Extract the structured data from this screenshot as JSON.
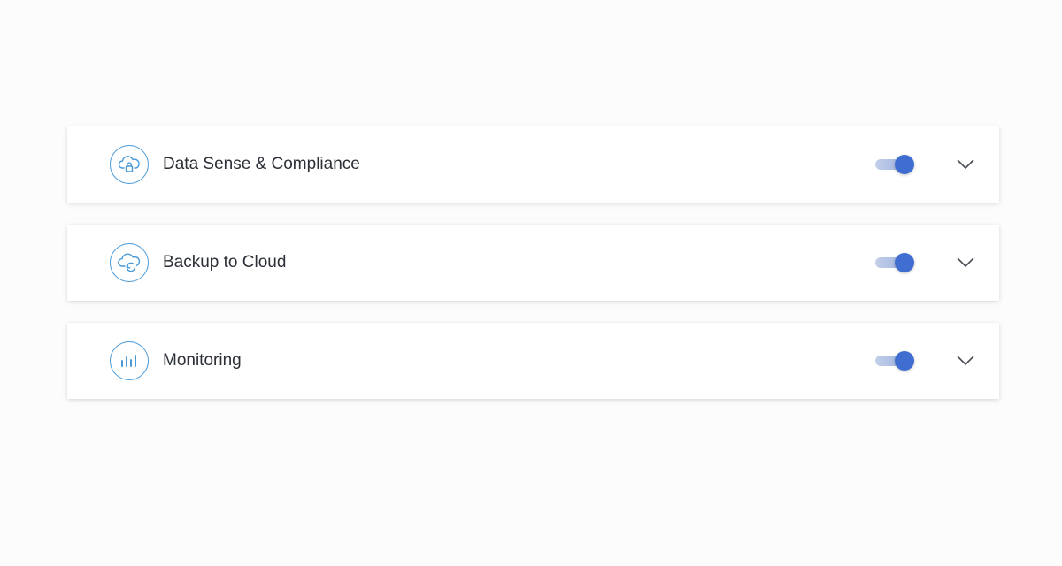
{
  "services": [
    {
      "label": "Data Sense & Compliance",
      "icon": "cloud-lock-icon",
      "enabled": true
    },
    {
      "label": "Backup to Cloud",
      "icon": "cloud-backup-icon",
      "enabled": true
    },
    {
      "label": "Monitoring",
      "icon": "bar-chart-icon",
      "enabled": true
    }
  ],
  "colors": {
    "icon_accent": "#4a9ad8",
    "toggle_on": "#3f6ed0",
    "text": "#2b2f36"
  }
}
